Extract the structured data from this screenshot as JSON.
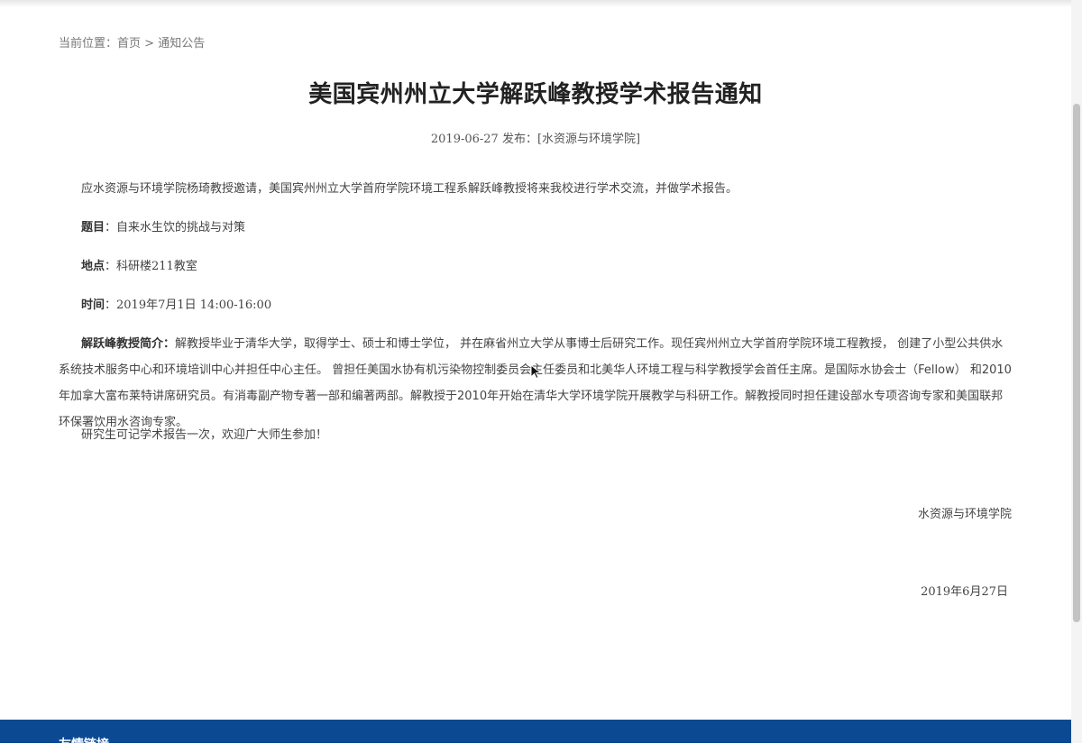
{
  "breadcrumb": {
    "prefix": "当前位置：",
    "home": "首页",
    "separator": " > ",
    "current": "通知公告"
  },
  "article": {
    "title": "美国宾州州立大学解跃峰教授学术报告通知",
    "meta": "2019-06-27 发布：[水资源与环境学院]",
    "intro": "应水资源与环境学院杨琦教授邀请，美国宾州州立大学首府学院环境工程系解跃峰教授将来我校进行学术交流，并做学术报告。",
    "topic_label": "题目",
    "topic_value": "：自来水生饮的挑战与对策",
    "location_label": "地点",
    "location_value": "：科研楼211教室",
    "time_label": "时间",
    "time_value": "：2019年7月1日 14:00-16:00",
    "bio_label": "解跃峰教授简介：",
    "bio_text": "解教授毕业于清华大学，取得学士、硕士和博士学位， 并在麻省州立大学从事博士后研究工作。现任宾州州立大学首府学院环境工程教授， 创建了小型公共供水系统技术服务中心和环境培训中心并担任中心主任。 曾担任美国水协有机污染物控制委员会主任委员和北美华人环境工程与科学教授学会首任主席。是国际水协会士（Fellow） 和2010年加拿大富布莱特讲席研究员。有消毒副产物专著一部和编著两部。解教授于2010年开始在清华大学环境学院开展教学与科研工作。解教授同时担任建设部水专项咨询专家和美国联邦环保署饮用水咨询专家。",
    "note": "研究生可记学术报告一次，欢迎广大师生参加！",
    "signature": "水资源与环境学院",
    "sign_date": "2019年6月27日"
  },
  "footer": {
    "title": "友情链接"
  },
  "colors": {
    "footer_bg": "#0b4a93",
    "title_text": "#222222"
  },
  "icons": [
    "mouse-cursor-icon"
  ]
}
